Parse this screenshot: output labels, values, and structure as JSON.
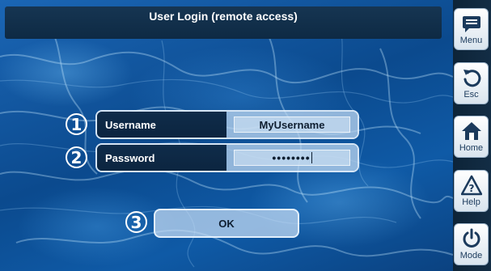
{
  "window": {
    "title": "User Login (remote access)"
  },
  "form": {
    "steps": [
      "1",
      "2",
      "3"
    ],
    "username": {
      "label": "Username",
      "value": "MyUsername"
    },
    "password": {
      "label": "Password",
      "masked_value": "••••••••"
    },
    "ok_label": "OK"
  },
  "sidebar": {
    "items": [
      {
        "label": "Menu",
        "icon": "menu-icon"
      },
      {
        "label": "Esc",
        "icon": "undo-icon"
      },
      {
        "label": "Home",
        "icon": "home-icon"
      },
      {
        "label": "Help",
        "icon": "help-icon"
      },
      {
        "label": "Mode",
        "icon": "power-icon"
      }
    ]
  },
  "colors": {
    "accent": "#1b3a5c",
    "water": "#0d4e94",
    "bar": "#0e2a44"
  }
}
